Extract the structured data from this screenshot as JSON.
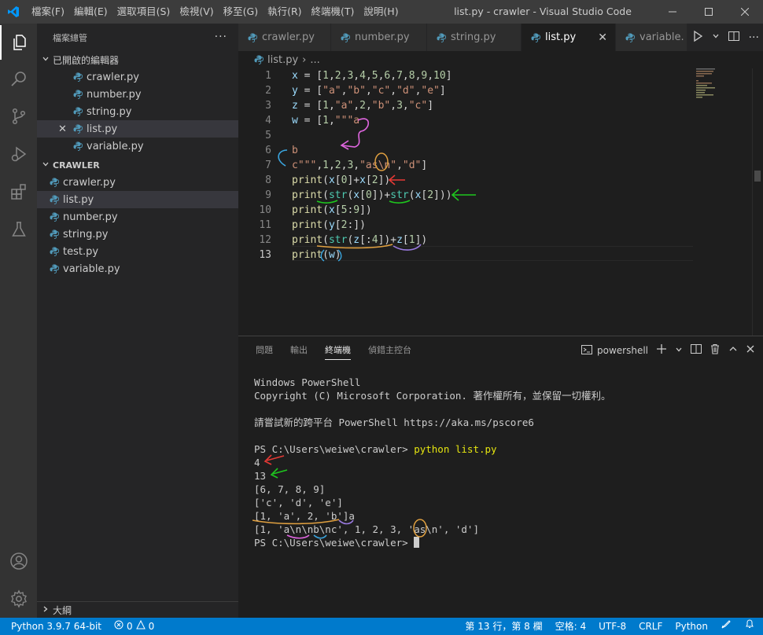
{
  "window": {
    "title": "list.py - crawler - Visual Studio Code"
  },
  "menu": [
    "檔案(F)",
    "編輯(E)",
    "選取項目(S)",
    "檢視(V)",
    "移至(G)",
    "執行(R)",
    "終端機(T)",
    "說明(H)"
  ],
  "sidebar": {
    "header": "檔案總管",
    "more": "···",
    "open_editors": {
      "label": "已開啟的編輯器",
      "items": [
        "crawler.py",
        "number.py",
        "string.py",
        "list.py",
        "variable.py"
      ]
    },
    "folder": {
      "label": "CRAWLER",
      "items": [
        "crawler.py",
        "list.py",
        "number.py",
        "string.py",
        "test.py",
        "variable.py"
      ]
    },
    "outline_label": "大綱"
  },
  "tabs": [
    "crawler.py",
    "number.py",
    "string.py",
    "list.py",
    "variable."
  ],
  "breadcrumb": {
    "file": "list.py",
    "sep": "›",
    "rest": "..."
  },
  "editor": {
    "line_numbers": [
      "1",
      "2",
      "3",
      "4",
      "5",
      "6",
      "7",
      "8",
      "9",
      "10",
      "11",
      "12",
      "13"
    ],
    "lines": [
      "x = [1,2,3,4,5,6,7,8,9,10]",
      "y = [\"a\",\"b\",\"c\",\"d\",\"e\"]",
      "z = [1,\"a\",2,\"b\",3,\"c\"]",
      "w = [1,\"\"\"a",
      "",
      "b",
      "c\"\"\",1,2,3,\"as\\n\",\"d\"]",
      "print(x[0]+x[2])",
      "print(str(x[0])+str(x[2]))",
      "print(x[5:9])",
      "print(y[2:])",
      "print(str(z[:4])+z[1])",
      "print(w)"
    ]
  },
  "panel": {
    "tabs": [
      "問題",
      "輸出",
      "終端機",
      "偵錯主控台"
    ],
    "shell": "powershell",
    "terminal_lines": [
      "Windows PowerShell",
      "Copyright (C) Microsoft Corporation. 著作權所有，並保留一切權利。",
      "",
      "請嘗試新的跨平台 PowerShell https://aka.ms/pscore6",
      "",
      "PS C:\\Users\\weiwe\\crawler> ",
      "4",
      "13",
      "[6, 7, 8, 9]",
      "['c', 'd', 'e']",
      "[1, 'a', 2, 'b']a",
      "[1, 'a\\n\\nb\\nc', 1, 2, 3, 'as\\n', 'd']",
      "PS C:\\Users\\weiwe\\crawler> "
    ],
    "command": "python list.py"
  },
  "statusbar": {
    "python": "Python 3.9.7 64-bit",
    "errors": "0",
    "warnings": "0",
    "position": "第 13 行，第 8 欄",
    "spaces": "空格: 4",
    "encoding": "UTF-8",
    "eol": "CRLF",
    "language": "Python"
  },
  "colors": {
    "accent": "#007acc",
    "python_icon": "#519aba",
    "annot_red": "#e53935",
    "annot_green": "#1ec71e",
    "annot_pink": "#e066e0",
    "annot_orange": "#e0a040",
    "annot_blue": "#3aa6e0",
    "annot_purple": "#9a7ae0"
  }
}
